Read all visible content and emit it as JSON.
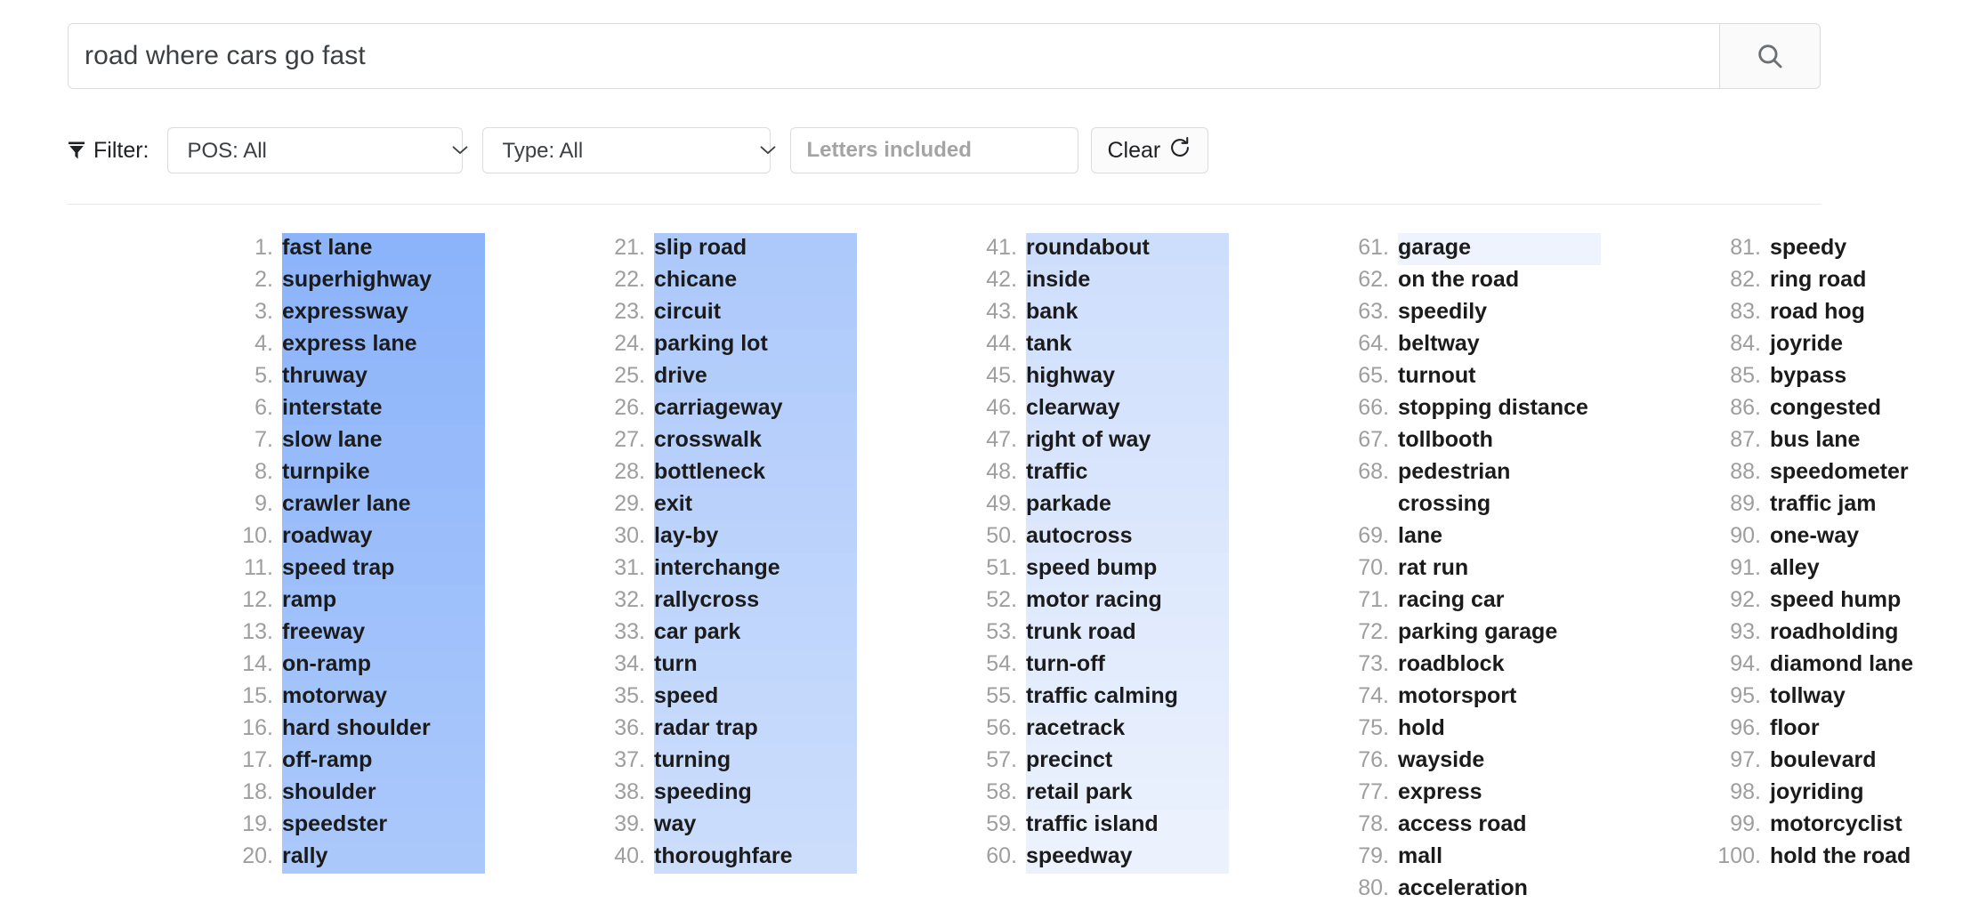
{
  "search": {
    "value": "road where cars go fast",
    "placeholder": "",
    "button_icon": "search-icon"
  },
  "filter": {
    "label": "Filter:",
    "icon": "funnel-icon",
    "pos_select": {
      "value": "POS: All"
    },
    "type_select": {
      "value": "Type: All"
    },
    "letters_input": {
      "value": "",
      "placeholder": "Letters included"
    },
    "clear_button": {
      "label": "Clear",
      "icon": "refresh-icon"
    }
  },
  "colors": {
    "highlight_start": "#8cb4fa",
    "highlight_end": "#eef3fd",
    "number": "#9e9e9e",
    "word": "#1b1b1b",
    "border": "#dcdcde"
  },
  "results": {
    "highlight_count": 61,
    "columns": [
      {
        "items": [
          {
            "rank": "1.",
            "word": "fast lane"
          },
          {
            "rank": "2.",
            "word": "superhighway"
          },
          {
            "rank": "3.",
            "word": "expressway"
          },
          {
            "rank": "4.",
            "word": "express lane"
          },
          {
            "rank": "5.",
            "word": "thruway"
          },
          {
            "rank": "6.",
            "word": "interstate"
          },
          {
            "rank": "7.",
            "word": "slow lane"
          },
          {
            "rank": "8.",
            "word": "turnpike"
          },
          {
            "rank": "9.",
            "word": "crawler lane"
          },
          {
            "rank": "10.",
            "word": "roadway"
          },
          {
            "rank": "11.",
            "word": "speed trap"
          },
          {
            "rank": "12.",
            "word": "ramp"
          },
          {
            "rank": "13.",
            "word": "freeway"
          },
          {
            "rank": "14.",
            "word": "on-ramp"
          },
          {
            "rank": "15.",
            "word": "motorway"
          },
          {
            "rank": "16.",
            "word": "hard shoulder"
          },
          {
            "rank": "17.",
            "word": "off-ramp"
          },
          {
            "rank": "18.",
            "word": "shoulder"
          },
          {
            "rank": "19.",
            "word": "speedster"
          },
          {
            "rank": "20.",
            "word": "rally"
          }
        ]
      },
      {
        "items": [
          {
            "rank": "21.",
            "word": "slip road"
          },
          {
            "rank": "22.",
            "word": "chicane"
          },
          {
            "rank": "23.",
            "word": "circuit"
          },
          {
            "rank": "24.",
            "word": "parking lot"
          },
          {
            "rank": "25.",
            "word": "drive"
          },
          {
            "rank": "26.",
            "word": "carriageway"
          },
          {
            "rank": "27.",
            "word": "crosswalk"
          },
          {
            "rank": "28.",
            "word": "bottleneck"
          },
          {
            "rank": "29.",
            "word": "exit"
          },
          {
            "rank": "30.",
            "word": "lay-by"
          },
          {
            "rank": "31.",
            "word": "interchange"
          },
          {
            "rank": "32.",
            "word": "rallycross"
          },
          {
            "rank": "33.",
            "word": "car park"
          },
          {
            "rank": "34.",
            "word": "turn"
          },
          {
            "rank": "35.",
            "word": "speed"
          },
          {
            "rank": "36.",
            "word": "radar trap"
          },
          {
            "rank": "37.",
            "word": "turning"
          },
          {
            "rank": "38.",
            "word": "speeding"
          },
          {
            "rank": "39.",
            "word": "way"
          },
          {
            "rank": "40.",
            "word": "thoroughfare"
          }
        ]
      },
      {
        "items": [
          {
            "rank": "41.",
            "word": "roundabout"
          },
          {
            "rank": "42.",
            "word": "inside"
          },
          {
            "rank": "43.",
            "word": "bank"
          },
          {
            "rank": "44.",
            "word": "tank"
          },
          {
            "rank": "45.",
            "word": "highway"
          },
          {
            "rank": "46.",
            "word": "clearway"
          },
          {
            "rank": "47.",
            "word": "right of way"
          },
          {
            "rank": "48.",
            "word": "traffic"
          },
          {
            "rank": "49.",
            "word": "parkade"
          },
          {
            "rank": "50.",
            "word": "autocross"
          },
          {
            "rank": "51.",
            "word": "speed bump"
          },
          {
            "rank": "52.",
            "word": "motor racing"
          },
          {
            "rank": "53.",
            "word": "trunk road"
          },
          {
            "rank": "54.",
            "word": "turn-off"
          },
          {
            "rank": "55.",
            "word": "traffic calming"
          },
          {
            "rank": "56.",
            "word": "racetrack"
          },
          {
            "rank": "57.",
            "word": "precinct"
          },
          {
            "rank": "58.",
            "word": "retail park"
          },
          {
            "rank": "59.",
            "word": "traffic island"
          },
          {
            "rank": "60.",
            "word": "speedway"
          }
        ]
      },
      {
        "items": [
          {
            "rank": "61.",
            "word": "garage"
          },
          {
            "rank": "62.",
            "word": "on the road"
          },
          {
            "rank": "63.",
            "word": "speedily"
          },
          {
            "rank": "64.",
            "word": "beltway"
          },
          {
            "rank": "65.",
            "word": "turnout"
          },
          {
            "rank": "66.",
            "word": "stopping distance"
          },
          {
            "rank": "67.",
            "word": "tollbooth"
          },
          {
            "rank": "68.",
            "word": "pedestrian crossing"
          },
          {
            "rank": "69.",
            "word": "lane"
          },
          {
            "rank": "70.",
            "word": "rat run"
          },
          {
            "rank": "71.",
            "word": "racing car"
          },
          {
            "rank": "72.",
            "word": "parking garage"
          },
          {
            "rank": "73.",
            "word": "roadblock"
          },
          {
            "rank": "74.",
            "word": "motorsport"
          },
          {
            "rank": "75.",
            "word": "hold"
          },
          {
            "rank": "76.",
            "word": "wayside"
          },
          {
            "rank": "77.",
            "word": "express"
          },
          {
            "rank": "78.",
            "word": "access road"
          },
          {
            "rank": "79.",
            "word": "mall"
          },
          {
            "rank": "80.",
            "word": "acceleration"
          }
        ]
      },
      {
        "items": [
          {
            "rank": "81.",
            "word": "speedy"
          },
          {
            "rank": "82.",
            "word": "ring road"
          },
          {
            "rank": "83.",
            "word": "road hog"
          },
          {
            "rank": "84.",
            "word": "joyride"
          },
          {
            "rank": "85.",
            "word": "bypass"
          },
          {
            "rank": "86.",
            "word": "congested"
          },
          {
            "rank": "87.",
            "word": "bus lane"
          },
          {
            "rank": "88.",
            "word": "speedometer"
          },
          {
            "rank": "89.",
            "word": "traffic jam"
          },
          {
            "rank": "90.",
            "word": "one-way"
          },
          {
            "rank": "91.",
            "word": "alley"
          },
          {
            "rank": "92.",
            "word": "speed hump"
          },
          {
            "rank": "93.",
            "word": "roadholding"
          },
          {
            "rank": "94.",
            "word": "diamond lane"
          },
          {
            "rank": "95.",
            "word": "tollway"
          },
          {
            "rank": "96.",
            "word": "floor"
          },
          {
            "rank": "97.",
            "word": "boulevard"
          },
          {
            "rank": "98.",
            "word": "joyriding"
          },
          {
            "rank": "99.",
            "word": "motorcyclist"
          },
          {
            "rank": "100.",
            "word": "hold the road"
          }
        ]
      }
    ]
  }
}
